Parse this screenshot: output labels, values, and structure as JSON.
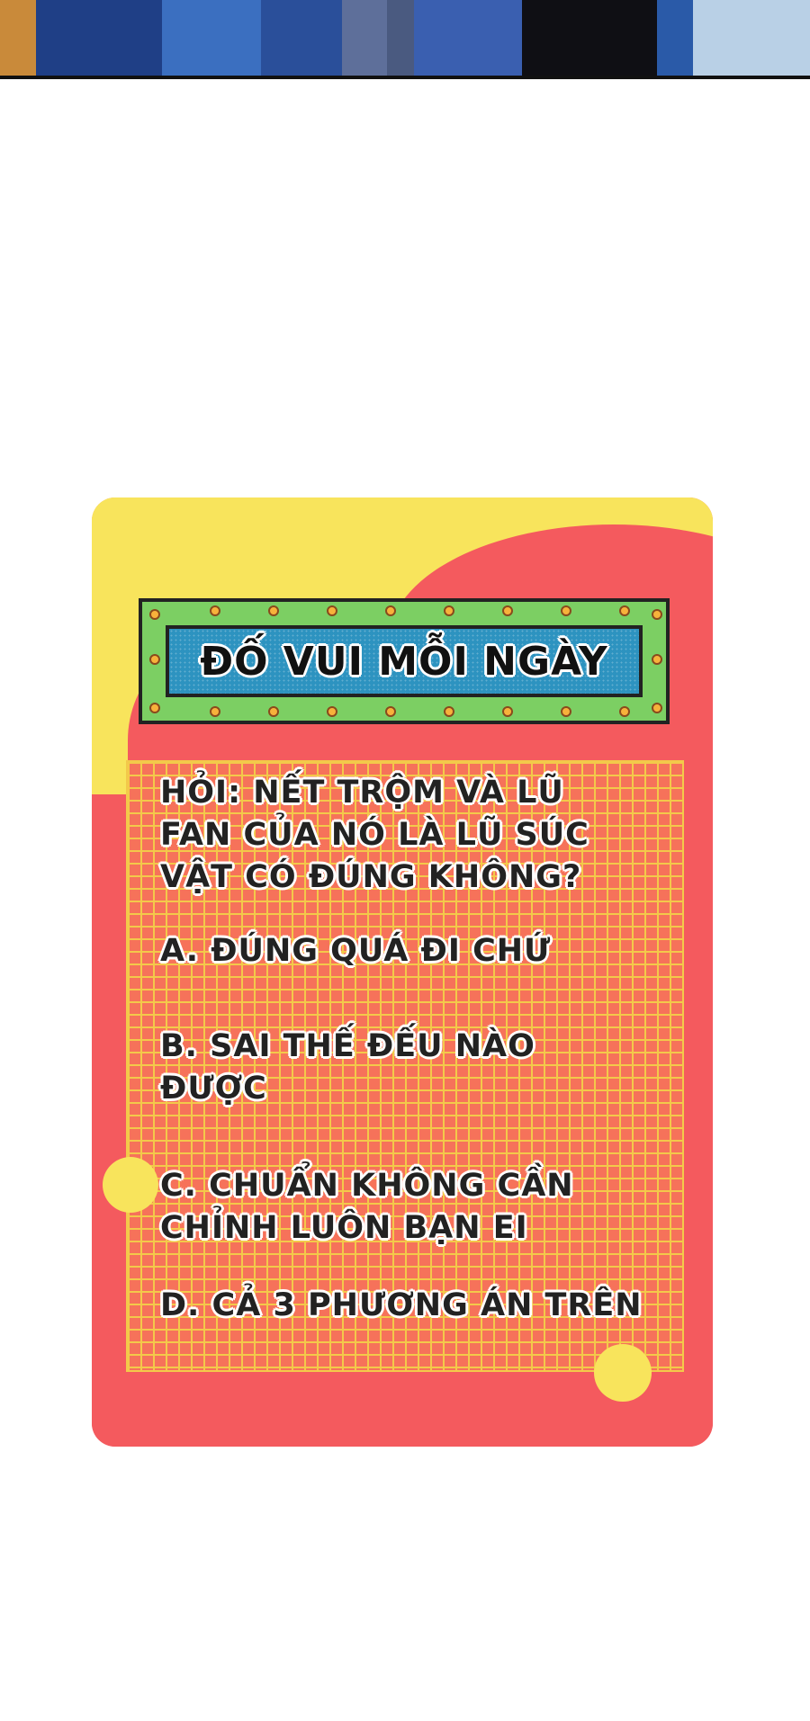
{
  "colors": {
    "card_yellow": "#f8e45c",
    "card_red": "#f45a5e",
    "grid_line": "#f3c94a",
    "sign_frame": "#7ccf63",
    "sign_panel": "#2d93c0",
    "text": "#222222"
  },
  "banner": {
    "title": "ĐỐ VUI MỖI NGÀY"
  },
  "quiz": {
    "question": "HỎI: NẾT TRỘM VÀ LŨ FAN CỦA NÓ LÀ LŨ SÚC VẬT CÓ ĐÚNG KHÔNG?",
    "options": [
      "A. ĐÚNG QUÁ ĐI CHỨ",
      "B. SAI THẾ ĐẾU NÀO ĐƯỢC",
      "C. CHUẨN KHÔNG CẦN CHỈNH LUÔN BẠN EI",
      "D. CẢ 3 PHƯƠNG ÁN TRÊN"
    ]
  }
}
